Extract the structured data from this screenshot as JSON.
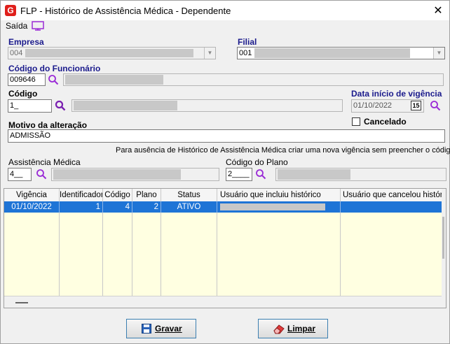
{
  "window": {
    "title": "FLP - Histórico de Assistência Médica - Dependente",
    "logo_letter": "G",
    "close_glyph": "✕"
  },
  "menu": {
    "exit_label": "Saída"
  },
  "empresa": {
    "label": "Empresa",
    "code": "004"
  },
  "filial": {
    "label": "Filial",
    "code": "001"
  },
  "funcionario": {
    "label": "Código do Funcionário",
    "code": "009646"
  },
  "codigo": {
    "label": "Código",
    "value": "1_"
  },
  "vigencia": {
    "label": "Data início de vigência",
    "value": "01/10/2022",
    "calendar_glyph": "15"
  },
  "motivo": {
    "label": "Motivo da alteração",
    "value": "ADMISSÃO"
  },
  "cancelado": {
    "label": "Cancelado",
    "checked": false
  },
  "hint": "Para ausência de Histórico de Assistência Médica criar uma nova vigência sem preencher o código",
  "assistencia": {
    "label": "Assistência Médica",
    "value": "4__"
  },
  "plano": {
    "label": "Código do Plano",
    "value": "2____"
  },
  "grid": {
    "columns": [
      "Vigência",
      "Identificador",
      "Código",
      "Plano",
      "Status",
      "Usuário que incluiu histórico",
      "Usuário que cancelou histórico"
    ],
    "rows": [
      {
        "vigencia": "01/10/2022",
        "identificador": "1",
        "codigo": "4",
        "plano": "2",
        "status": "ATIVO"
      }
    ]
  },
  "buttons": {
    "save_label": "Gravar",
    "clear_label": "Limpar"
  },
  "colors": {
    "accent": "#1e74d6",
    "label_blue": "#1a1a8c",
    "grid_bg": "#ffffe1",
    "logo_red": "#e0201c"
  },
  "icons": [
    "logo-icon",
    "close-icon",
    "monitor-icon",
    "search-icon",
    "calendar-icon",
    "save-icon",
    "eraser-icon"
  ]
}
